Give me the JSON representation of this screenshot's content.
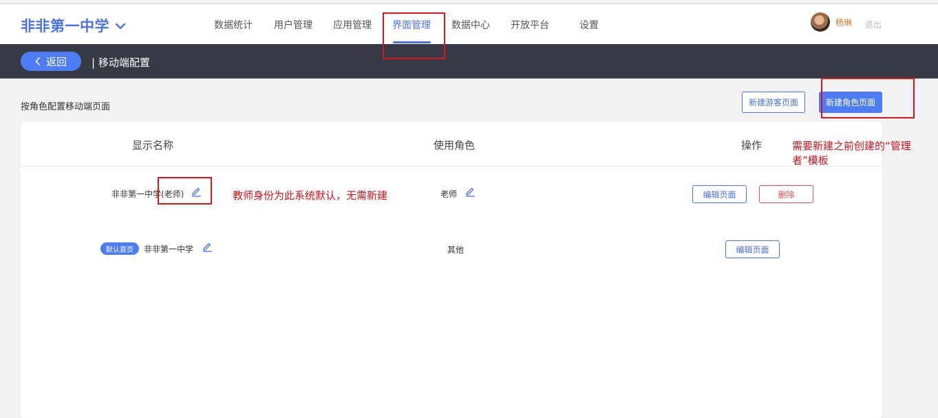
{
  "header": {
    "school_name": "非非第一中学",
    "nav": [
      "数据统计",
      "用户管理",
      "应用管理",
      "界面管理",
      "数据中心",
      "开放平台",
      "设置"
    ],
    "active_nav": "界面管理",
    "user_name": "杨琳",
    "logout_label": "退出"
  },
  "subheader": {
    "back_label": "返回",
    "title": "| 移动端配置"
  },
  "toolbar": {
    "section_label": "按角色配置移动端页面",
    "new_guest_page": "新建游客页面",
    "new_role_page": "新建角色页面"
  },
  "table": {
    "columns": [
      "显示名称",
      "使用角色",
      "操作"
    ],
    "rows": [
      {
        "badge": "",
        "name": "非非第一中学(老师)",
        "role": "老师",
        "actions": [
          "编辑页面",
          "删除"
        ]
      },
      {
        "badge": "默认首页",
        "name": "非非第一中学",
        "role": "其他",
        "actions": [
          "编辑页面"
        ]
      }
    ]
  },
  "annotations": {
    "teacher_note": "教师身份为此系统默认，无需新建",
    "role_note_line1": "需要新建之前创建的“管理",
    "role_note_line2": "者”模板"
  },
  "colors": {
    "accent": "#4a72e8",
    "subbar_bg": "#363a45",
    "danger": "#e04f4f",
    "annotation_red": "#d0121a"
  }
}
